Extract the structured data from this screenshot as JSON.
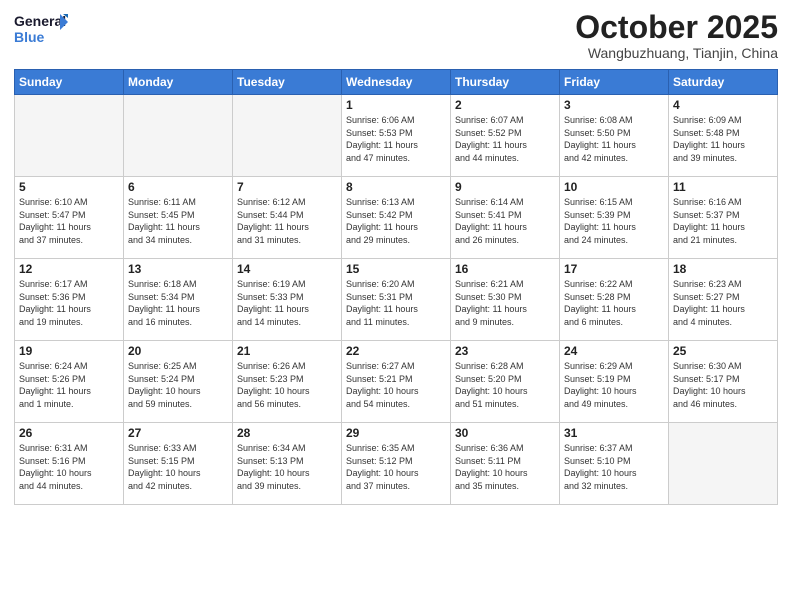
{
  "logo": {
    "line1": "General",
    "line2": "Blue"
  },
  "title": "October 2025",
  "location": "Wangbuzhuang, Tianjin, China",
  "weekdays": [
    "Sunday",
    "Monday",
    "Tuesday",
    "Wednesday",
    "Thursday",
    "Friday",
    "Saturday"
  ],
  "weeks": [
    [
      {
        "day": "",
        "info": ""
      },
      {
        "day": "",
        "info": ""
      },
      {
        "day": "",
        "info": ""
      },
      {
        "day": "1",
        "info": "Sunrise: 6:06 AM\nSunset: 5:53 PM\nDaylight: 11 hours\nand 47 minutes."
      },
      {
        "day": "2",
        "info": "Sunrise: 6:07 AM\nSunset: 5:52 PM\nDaylight: 11 hours\nand 44 minutes."
      },
      {
        "day": "3",
        "info": "Sunrise: 6:08 AM\nSunset: 5:50 PM\nDaylight: 11 hours\nand 42 minutes."
      },
      {
        "day": "4",
        "info": "Sunrise: 6:09 AM\nSunset: 5:48 PM\nDaylight: 11 hours\nand 39 minutes."
      }
    ],
    [
      {
        "day": "5",
        "info": "Sunrise: 6:10 AM\nSunset: 5:47 PM\nDaylight: 11 hours\nand 37 minutes."
      },
      {
        "day": "6",
        "info": "Sunrise: 6:11 AM\nSunset: 5:45 PM\nDaylight: 11 hours\nand 34 minutes."
      },
      {
        "day": "7",
        "info": "Sunrise: 6:12 AM\nSunset: 5:44 PM\nDaylight: 11 hours\nand 31 minutes."
      },
      {
        "day": "8",
        "info": "Sunrise: 6:13 AM\nSunset: 5:42 PM\nDaylight: 11 hours\nand 29 minutes."
      },
      {
        "day": "9",
        "info": "Sunrise: 6:14 AM\nSunset: 5:41 PM\nDaylight: 11 hours\nand 26 minutes."
      },
      {
        "day": "10",
        "info": "Sunrise: 6:15 AM\nSunset: 5:39 PM\nDaylight: 11 hours\nand 24 minutes."
      },
      {
        "day": "11",
        "info": "Sunrise: 6:16 AM\nSunset: 5:37 PM\nDaylight: 11 hours\nand 21 minutes."
      }
    ],
    [
      {
        "day": "12",
        "info": "Sunrise: 6:17 AM\nSunset: 5:36 PM\nDaylight: 11 hours\nand 19 minutes."
      },
      {
        "day": "13",
        "info": "Sunrise: 6:18 AM\nSunset: 5:34 PM\nDaylight: 11 hours\nand 16 minutes."
      },
      {
        "day": "14",
        "info": "Sunrise: 6:19 AM\nSunset: 5:33 PM\nDaylight: 11 hours\nand 14 minutes."
      },
      {
        "day": "15",
        "info": "Sunrise: 6:20 AM\nSunset: 5:31 PM\nDaylight: 11 hours\nand 11 minutes."
      },
      {
        "day": "16",
        "info": "Sunrise: 6:21 AM\nSunset: 5:30 PM\nDaylight: 11 hours\nand 9 minutes."
      },
      {
        "day": "17",
        "info": "Sunrise: 6:22 AM\nSunset: 5:28 PM\nDaylight: 11 hours\nand 6 minutes."
      },
      {
        "day": "18",
        "info": "Sunrise: 6:23 AM\nSunset: 5:27 PM\nDaylight: 11 hours\nand 4 minutes."
      }
    ],
    [
      {
        "day": "19",
        "info": "Sunrise: 6:24 AM\nSunset: 5:26 PM\nDaylight: 11 hours\nand 1 minute."
      },
      {
        "day": "20",
        "info": "Sunrise: 6:25 AM\nSunset: 5:24 PM\nDaylight: 10 hours\nand 59 minutes."
      },
      {
        "day": "21",
        "info": "Sunrise: 6:26 AM\nSunset: 5:23 PM\nDaylight: 10 hours\nand 56 minutes."
      },
      {
        "day": "22",
        "info": "Sunrise: 6:27 AM\nSunset: 5:21 PM\nDaylight: 10 hours\nand 54 minutes."
      },
      {
        "day": "23",
        "info": "Sunrise: 6:28 AM\nSunset: 5:20 PM\nDaylight: 10 hours\nand 51 minutes."
      },
      {
        "day": "24",
        "info": "Sunrise: 6:29 AM\nSunset: 5:19 PM\nDaylight: 10 hours\nand 49 minutes."
      },
      {
        "day": "25",
        "info": "Sunrise: 6:30 AM\nSunset: 5:17 PM\nDaylight: 10 hours\nand 46 minutes."
      }
    ],
    [
      {
        "day": "26",
        "info": "Sunrise: 6:31 AM\nSunset: 5:16 PM\nDaylight: 10 hours\nand 44 minutes."
      },
      {
        "day": "27",
        "info": "Sunrise: 6:33 AM\nSunset: 5:15 PM\nDaylight: 10 hours\nand 42 minutes."
      },
      {
        "day": "28",
        "info": "Sunrise: 6:34 AM\nSunset: 5:13 PM\nDaylight: 10 hours\nand 39 minutes."
      },
      {
        "day": "29",
        "info": "Sunrise: 6:35 AM\nSunset: 5:12 PM\nDaylight: 10 hours\nand 37 minutes."
      },
      {
        "day": "30",
        "info": "Sunrise: 6:36 AM\nSunset: 5:11 PM\nDaylight: 10 hours\nand 35 minutes."
      },
      {
        "day": "31",
        "info": "Sunrise: 6:37 AM\nSunset: 5:10 PM\nDaylight: 10 hours\nand 32 minutes."
      },
      {
        "day": "",
        "info": ""
      }
    ]
  ]
}
